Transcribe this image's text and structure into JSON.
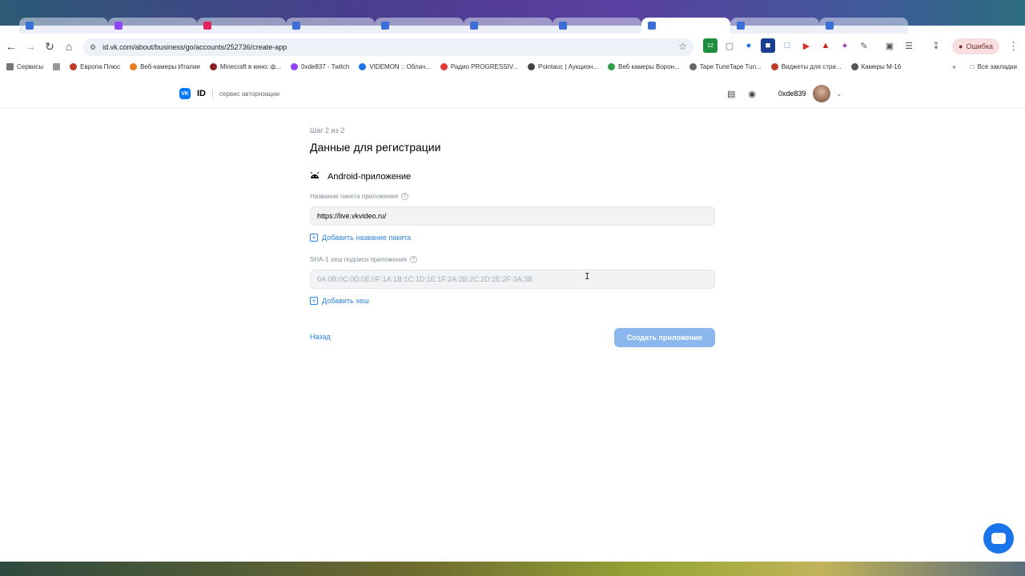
{
  "browser": {
    "url": "id.vk.com/about/business/go/accounts/252736/create-app",
    "error_label": "Ошибка",
    "bookmarks": [
      "Сервисы",
      "Европа Плюс",
      "Веб-камеры Италии",
      "Minecraft в кино: ф...",
      "0xde837 - Twitch",
      "VIDEMON :: Облач...",
      "Радио PROGRESSIV...",
      "Pointauc | Аукцион...",
      "Веб камеры Ворон...",
      "Tape TuneTape Tun...",
      "Виджеты для стри...",
      "Камеры М-16"
    ],
    "all_bookmarks": "Все закладки",
    "extension_badge": "12"
  },
  "header": {
    "brand": "ID",
    "vk_mark": "VK",
    "service": "сервис авторизации",
    "username": "0xde839"
  },
  "form": {
    "step": "Шаг 2 из 2",
    "title": "Данные для регистрации",
    "platform": "Android-приложение",
    "package_label": "Название пакета приложения",
    "package_value": "https://live.vkvideo.ru/",
    "add_package": "Добавить название пакета",
    "sha_label": "SHA-1 хеш подписи приложения",
    "sha_placeholder": "0A:0B:0C:0D:0E:0F:1A:1B:1C:1D:1E:1F:2A:2B:2C:2D:2E:2F:3A:3B",
    "add_hash": "Добавить хеш",
    "back": "Назад",
    "create": "Создать приложение"
  },
  "colors": {
    "accent": "#2d81e0",
    "button_disabled": "#8ab8ee",
    "vk_blue": "#0077ff"
  }
}
